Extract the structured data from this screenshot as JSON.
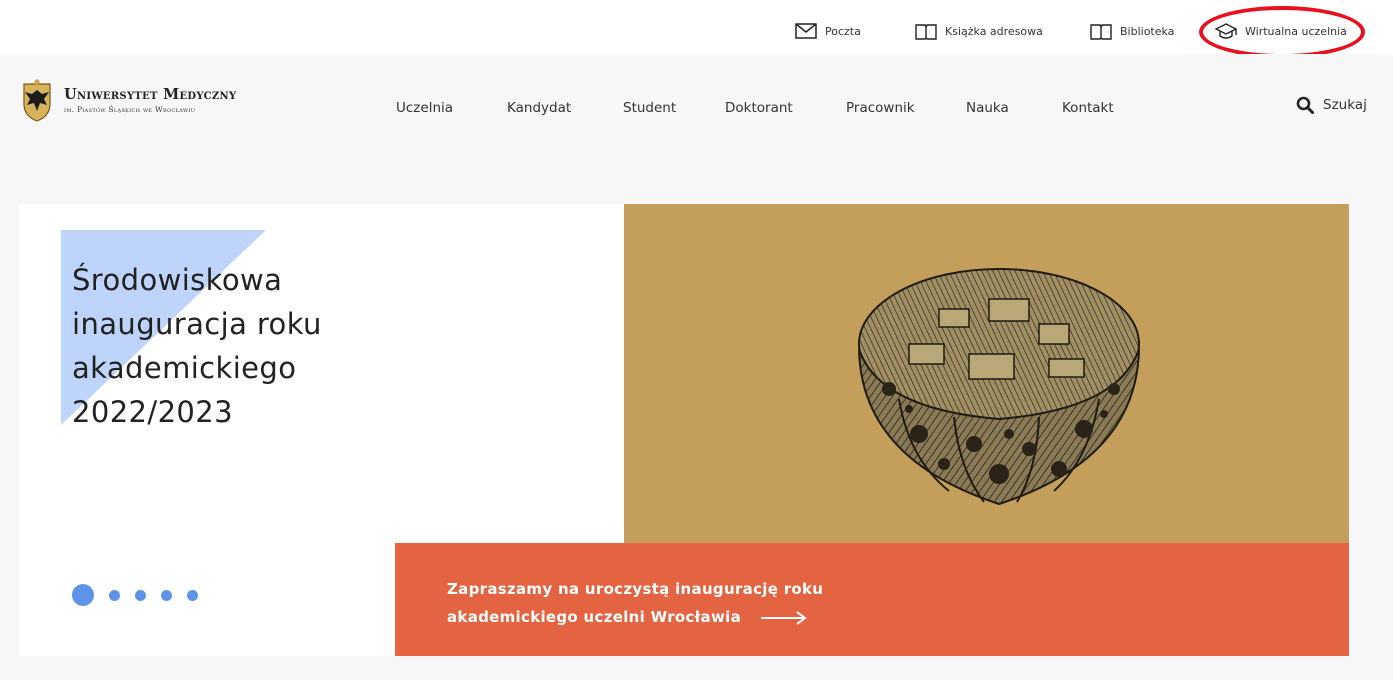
{
  "top_links": [
    {
      "label": "Poczta",
      "icon": "mail-icon"
    },
    {
      "label": "Książka adresowa",
      "icon": "book-icon"
    },
    {
      "label": "Biblioteka",
      "icon": "book-icon"
    },
    {
      "label": "Wirtualna uczelnia",
      "icon": "graduation-cap-icon"
    }
  ],
  "logo": {
    "name": "Uniwersytet Medyczny",
    "subtitle": "im. Piastów Śląskich we Wrocławiu"
  },
  "nav": {
    "items": [
      "Uczelnia",
      "Kandydat",
      "Student",
      "Doktorant",
      "Pracownik",
      "Nauka",
      "Kontakt"
    ],
    "search_label": "Szukaj"
  },
  "hero": {
    "title": "Środowiskowa inauguracja roku akademickiego 2022/2023",
    "cta_line1": "Zapraszamy na uroczystą inaugurację roku",
    "cta_line2": "akademickiego uczelni Wrocławia",
    "slide_count": 5,
    "active_slide": 1
  },
  "colors": {
    "highlight": "#e8101c",
    "accent_blue": "#5d93e8",
    "cta_orange": "#e46340",
    "image_gold": "#c39f5b"
  }
}
